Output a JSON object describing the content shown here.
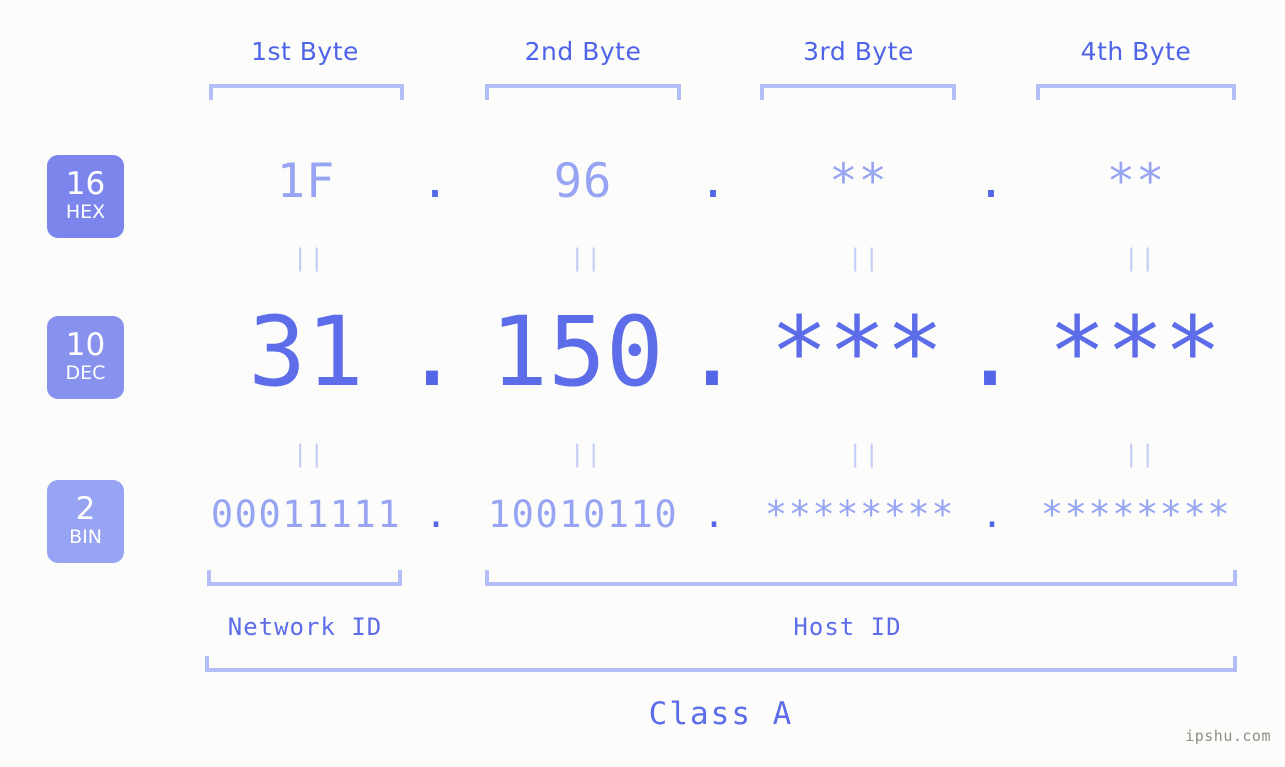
{
  "meta": {
    "background_color": "#fcfdfa",
    "accent_dark": "#5d6ce9",
    "accent_mid": "#7b85ec",
    "accent_light": "#97a4f3",
    "bracket_color": "#b3bdf7",
    "connector_color": "#c3cbf8"
  },
  "headers": {
    "byte1": "1st Byte",
    "byte2": "2nd Byte",
    "byte3": "3rd Byte",
    "byte4": "4th Byte"
  },
  "badges": [
    {
      "number": "16",
      "abbr": "HEX",
      "color": "#7b85ec"
    },
    {
      "number": "10",
      "abbr": "DEC",
      "color": "#8791ee"
    },
    {
      "number": "2",
      "abbr": "BIN",
      "color": "#97a4f3"
    }
  ],
  "separators": {
    "dot": "."
  },
  "connectors": {
    "equals": "||"
  },
  "rows": {
    "hex": {
      "base_label": "16",
      "base_abbr": "HEX",
      "bytes": [
        "1F",
        "96",
        "**",
        "**"
      ]
    },
    "dec": {
      "base_label": "10",
      "base_abbr": "DEC",
      "bytes": [
        "31",
        "150",
        "***",
        "***"
      ]
    },
    "bin": {
      "base_label": "2",
      "base_abbr": "BIN",
      "bytes": [
        "00011111",
        "10010110",
        "********",
        "********"
      ]
    }
  },
  "segments": {
    "network_id": "Network ID",
    "host_id": "Host ID"
  },
  "class": {
    "label": "Class A"
  },
  "watermark": {
    "text": "ipshu.com"
  }
}
